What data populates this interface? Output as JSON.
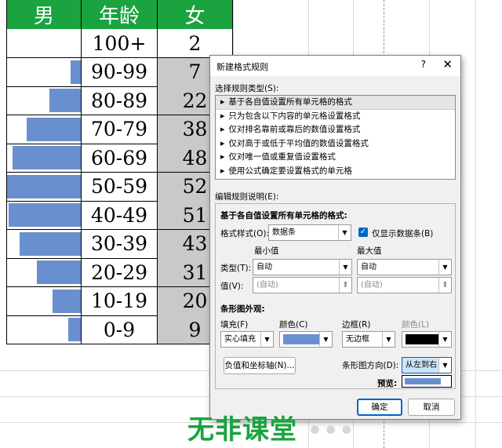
{
  "sheet": {
    "headers": {
      "male": "男",
      "age": "年龄",
      "female": "女"
    },
    "rows": [
      {
        "age": "100+",
        "female": "2",
        "male_bar": 0,
        "female_shaded": false
      },
      {
        "age": "90-99",
        "female": "7",
        "male_bar": 7,
        "female_shaded": true
      },
      {
        "age": "80-89",
        "female": "22",
        "male_bar": 22,
        "female_shaded": true
      },
      {
        "age": "70-79",
        "female": "38",
        "male_bar": 38,
        "female_shaded": true
      },
      {
        "age": "60-69",
        "female": "48",
        "male_bar": 48,
        "female_shaded": true
      },
      {
        "age": "50-59",
        "female": "52",
        "male_bar": 52,
        "female_shaded": true
      },
      {
        "age": "40-49",
        "female": "51",
        "male_bar": 51,
        "female_shaded": true
      },
      {
        "age": "30-39",
        "female": "43",
        "male_bar": 43,
        "female_shaded": true
      },
      {
        "age": "20-29",
        "female": "31",
        "male_bar": 31,
        "female_shaded": true
      },
      {
        "age": "10-19",
        "female": "20",
        "male_bar": 20,
        "female_shaded": true
      },
      {
        "age": "0-9",
        "female": "9",
        "male_bar": 9,
        "female_shaded": true
      }
    ],
    "bar_max": 52
  },
  "dialog": {
    "title": "新建格式规则",
    "help": "?",
    "close": "✕",
    "select_rule_type_label": "选择规则类型(S):",
    "rule_types": [
      "基于各自值设置所有单元格的格式",
      "只为包含以下内容的单元格设置格式",
      "仅对排名靠前或靠后的数值设置格式",
      "仅对高于或低于平均值的数值设置格式",
      "仅对唯一值或重复值设置格式",
      "使用公式确定要设置格式的单元格"
    ],
    "edit_rule_label": "编辑规则说明(E):",
    "format_all_label": "基于各自值设置所有单元格的格式:",
    "format_style_label": "格式样式(O):",
    "format_style_value": "数据条",
    "show_bar_only_label": "仅显示数据条(B)",
    "show_bar_only_checked": "✓",
    "min_label": "最小值",
    "max_label": "最大值",
    "type_label": "类型(T):",
    "min_type": "自动",
    "max_type": "自动",
    "value_label": "值(V):",
    "min_value": "(自动)",
    "max_value": "(自动)",
    "bar_appearance_label": "条形图外观:",
    "fill_label": "填充(F)",
    "fill_value": "实心填充",
    "color_label": "颜色(C)",
    "border_label": "边框(R)",
    "border_value": "无边框",
    "border_color_label": "颜色(L)",
    "bar_color": "#6a8fce",
    "border_color": "#000000",
    "neg_axis_button": "负值和坐标轴(N)...",
    "direction_label": "条形图方向(D):",
    "direction_value": "从左到右",
    "preview_label": "预览:",
    "ok_button": "确定",
    "cancel_button": "取消"
  },
  "watermark": {
    "text": "无非课堂",
    "dots": "•••"
  },
  "colors": {
    "header_green": "#1aa33f",
    "annotation_red": "#e0202a",
    "selection_blue": "#0067c0"
  }
}
